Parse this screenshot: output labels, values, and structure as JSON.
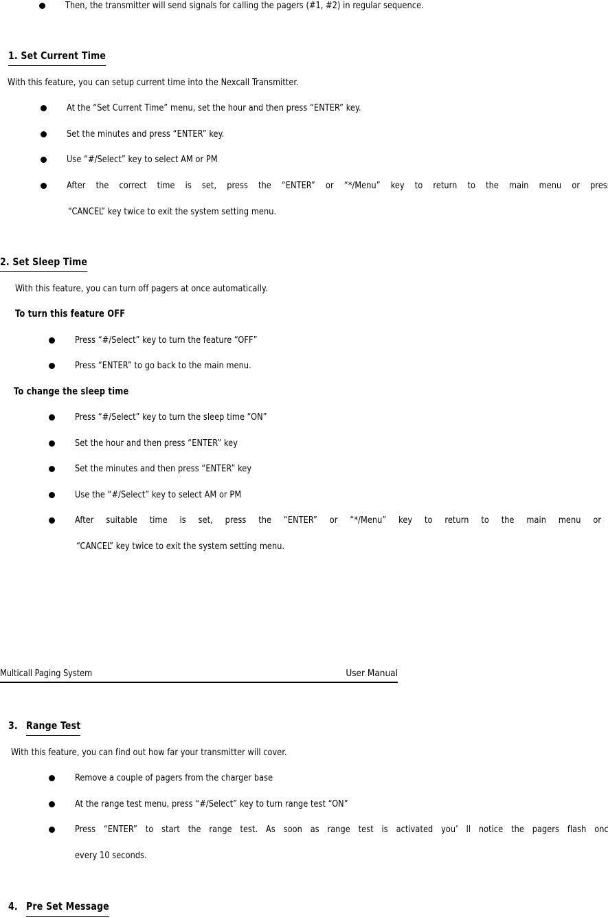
{
  "document": {
    "title": "Multicall Paging System User Manual",
    "footer": {
      "left": "Multicall Paging System",
      "right": "User   Manual"
    }
  },
  "intro_bullet": "Then, the transmitter will send signals for calling the pagers (#1, #2) in regular sequence.",
  "sections": [
    {
      "number": "1.",
      "title": "Set Current Time",
      "heading_full": "1. Set Current Time",
      "intro": "With this feature, you can setup current time into the Nexcall Transmitter.",
      "bullets": [
        "At the  “Set Current Time”  menu, set the hour and then press  “ENTER”  key.",
        "Set the minutes and press  “ENTER”  key.",
        "Use  “#/Select”  key to select AM or PM",
        "After the correct time is set, press the  “ENTER”  or  “*/Menu”  key to return to the main menu or press the"
      ],
      "bullet_continuation": "“CANCEL”  key twice to exit the system setting menu."
    },
    {
      "number": "2.",
      "title": "Set Sleep Time",
      "heading_full": "2. Set Sleep Time",
      "intro": "With this feature, you can turn off pagers at once automatically.",
      "subheading_1": "To turn this feature OFF",
      "bullets_1": [
        "Press  “#/Select”  key to turn the feature  “OFF”",
        "Press  “ENTER”  to go back to the main menu."
      ],
      "subheading_2": "To change the sleep time",
      "bullets_2": [
        "Press  “#/Select”  key to turn the sleep time  “ON”",
        "Set the hour and then press  “ENTER”  key",
        "Set the minutes and then press  “ENTER”  key",
        "Use the  “#/Select”  key to select AM or PM",
        "After suitable time is set, press the  “ENTER”  or  “*/Menu”  key to return to the main menu or press"
      ],
      "bullet_continuation": "“CANCEL”  key twice to exit the system setting menu."
    },
    {
      "number": "3.",
      "title": "Range Test",
      "intro": "With this feature, you can find out how far your transmitter will cover.",
      "bullets": [
        "Remove a couple of pagers from the charger base",
        "At the range test menu, press  “#/Select”  key to turn range test  “ON”",
        "Press  “ENTER”  to start the range test. As soon as range test is activated you’ ll notice the pagers flash once per"
      ],
      "bullet_continuation": "every 10 seconds."
    },
    {
      "number": "4.",
      "title": "Pre Set Message"
    }
  ]
}
